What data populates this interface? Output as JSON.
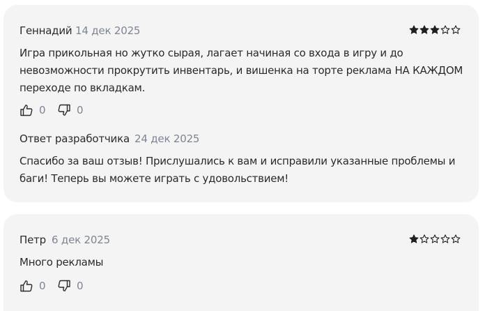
{
  "reviews": [
    {
      "author": "Геннадий",
      "date": "14 дек 2025",
      "rating": 3,
      "rating_max": 5,
      "text": "Игра прикольная но жутко сырая, лагает начиная со входа в игру и до невозможности прокрутить инвентарь, и вишенка на торте реклама НА КАЖДОМ переходе по вкладкам.",
      "likes": "0",
      "dislikes": "0",
      "developer_reply": {
        "label": "Ответ разработчика",
        "date": "24 дек 2025",
        "text": "Спасибо за ваш отзыв! Прислушались к вам и исправили указанные проблемы и баги! Теперь вы можете играть с удовольствием!"
      }
    },
    {
      "author": "Петр",
      "date": "6 дек 2025",
      "rating": 1,
      "rating_max": 5,
      "text": "Много рекламы",
      "likes": "0",
      "dislikes": "0"
    }
  ],
  "colors": {
    "card_background": "#f4f4f4",
    "star": "#1f1f1f",
    "muted_text": "#7d8493"
  }
}
